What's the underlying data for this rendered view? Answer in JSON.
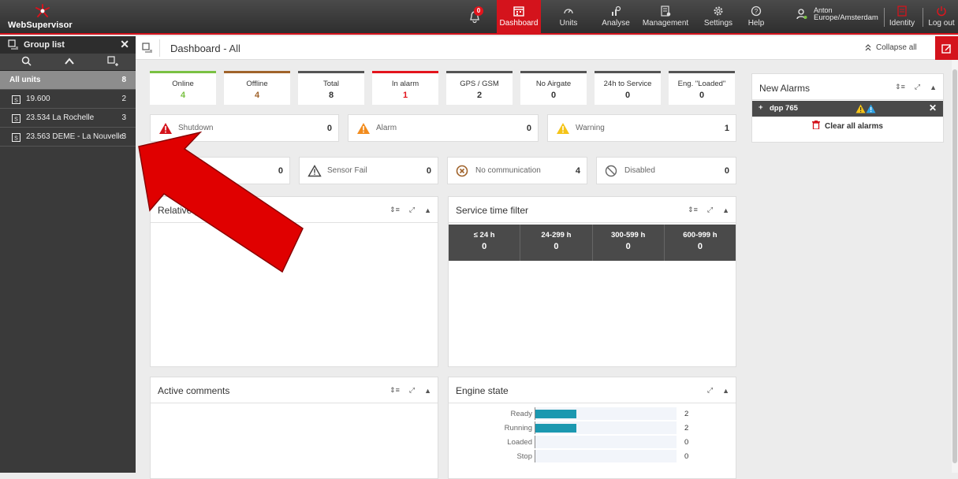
{
  "app": {
    "logo_text": "WebSupervisor"
  },
  "topbar": {
    "bell_badge": "0",
    "nav": [
      {
        "id": "dashboard",
        "label": "Dashboard",
        "icon": "dashboard-icon",
        "active": true
      },
      {
        "id": "units",
        "label": "Units",
        "icon": "gauge-icon"
      },
      {
        "id": "analyse",
        "label": "Analyse",
        "icon": "analyse-icon"
      },
      {
        "id": "management",
        "label": "Management",
        "icon": "management-icon"
      },
      {
        "id": "settings",
        "label": "Settings",
        "icon": "gear-icon"
      },
      {
        "id": "help",
        "label": "Help",
        "icon": "help-icon"
      }
    ],
    "user_name": "Anton",
    "timezone": "Europe/Amsterdam",
    "identity_label": "Identity",
    "logout_label": "Log out"
  },
  "sidebar": {
    "title": "Group list",
    "items": [
      {
        "label": "All units",
        "count": "8"
      },
      {
        "label": "19.600",
        "count": "2"
      },
      {
        "label": "23.534 La Rochelle",
        "count": "3"
      },
      {
        "label": "23.563 DEME - La Nouvelle",
        "count": "3"
      }
    ]
  },
  "page": {
    "title_main": "Dashboard",
    "title_sep": " - ",
    "title_sub": "All",
    "collapse_all": "Collapse all"
  },
  "stats": [
    {
      "label": "Online",
      "value": "4",
      "color": "#7ac143"
    },
    {
      "label": "Offline",
      "value": "4",
      "color": "#a0632b"
    },
    {
      "label": "Total",
      "value": "8",
      "color": "#555555"
    },
    {
      "label": "In alarm",
      "value": "1",
      "color": "#e3141c"
    },
    {
      "label": "GPS / GSM",
      "value": "2",
      "color": "#555555"
    },
    {
      "label": "No Airgate",
      "value": "0",
      "color": "#555555"
    },
    {
      "label": "24h to Service",
      "value": "0",
      "color": "#555555"
    },
    {
      "label": "Eng. \"Loaded\"",
      "value": "0",
      "color": "#555555"
    }
  ],
  "alarm_tiles": [
    {
      "label": "Shutdown",
      "value": "0"
    },
    {
      "label": "Alarm",
      "value": "0"
    },
    {
      "label": "Warning",
      "value": "1"
    },
    {
      "label": "",
      "value": "0"
    },
    {
      "label": "Sensor Fail",
      "value": "0"
    },
    {
      "label": "No communication",
      "value": "4"
    },
    {
      "label": "Disabled",
      "value": "0"
    }
  ],
  "panels": {
    "relative": {
      "title": "Relative po"
    },
    "service": {
      "title": "Service time filter",
      "cells": [
        {
          "label": "≤ 24 h",
          "value": "0"
        },
        {
          "label": "24-299 h",
          "value": "0"
        },
        {
          "label": "300-599 h",
          "value": "0"
        },
        {
          "label": "600-999 h",
          "value": "0"
        }
      ]
    },
    "comments": {
      "title": "Active comments"
    },
    "engine": {
      "title": "Engine state",
      "rows": [
        {
          "label": "Ready",
          "value": "2",
          "fraction": 0.29
        },
        {
          "label": "Running",
          "value": "2",
          "fraction": 0.29
        },
        {
          "label": "Loaded",
          "value": "0",
          "fraction": 0
        },
        {
          "label": "Stop",
          "value": "0",
          "fraction": 0
        }
      ]
    },
    "new_alarms": {
      "title": "New Alarms",
      "item_label": "dpp 765",
      "clear_label": "Clear all alarms"
    }
  },
  "colors": {
    "brand_red": "#d4131c",
    "bar_teal": "#1b98b0",
    "arrow_red": "#e00000"
  }
}
